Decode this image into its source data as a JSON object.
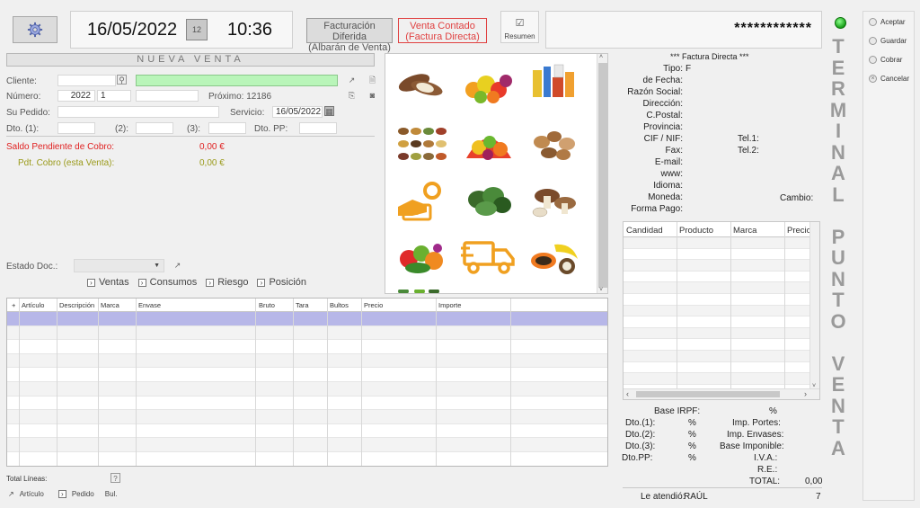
{
  "header": {
    "date": "16/05/2022",
    "time": "10:36",
    "cal_day": "12",
    "mode_deferred_line1": "Facturación Diferida",
    "mode_deferred_line2": "(Albarán de Venta)",
    "mode_cash_line1": "Venta Contado",
    "mode_cash_line2": "(Factura Directa)",
    "summary_label": "Resumen",
    "user_masked": "************"
  },
  "terminal_letters": [
    "T",
    "E",
    "R",
    "M",
    "I",
    "N",
    "A",
    "L",
    "",
    "P",
    "U",
    "N",
    "T",
    "O",
    "",
    "V",
    "E",
    "N",
    "T",
    "A"
  ],
  "side_actions": [
    "Aceptar",
    "Guardar",
    "Cobrar",
    "Cancelar"
  ],
  "form": {
    "title": "NUEVA VENTA",
    "cliente_label": "Cliente:",
    "numero_label": "Número:",
    "numero_year": "2022",
    "numero_value": "1",
    "proximo_label": "Próximo:",
    "proximo_value": "12186",
    "su_pedido_label": "Su Pedido:",
    "servicio_label": "Servicio:",
    "servicio_value": "16/05/2022",
    "dto1_label": "Dto. (1):",
    "dto2_label": "(2):",
    "dto3_label": "(3):",
    "dtopp_label": "Dto. PP:",
    "saldo_label": "Saldo Pendiente de Cobro:",
    "saldo_value": "0,00  €",
    "pdt_label": "Pdt. Cobro (esta Venta):",
    "pdt_value": "0,00  €",
    "estado_label": "Estado Doc.:",
    "links": [
      "Ventas",
      "Consumos",
      "Riesgo",
      "Posición"
    ]
  },
  "grid": {
    "columns": [
      "+",
      "Artículo",
      "Descripción",
      "Marca",
      "Envase",
      "Bruto",
      "Tara",
      "Bultos",
      "Precio",
      "Importe"
    ]
  },
  "footer": {
    "total_lineas_label": "Total Líneas:",
    "total_lineas_icon": "?",
    "articulo": "Artículo",
    "pedido": "Pedido",
    "bul": "Bul."
  },
  "invoice": {
    "heading": "*** Factura Directa ***",
    "tipo_label": "Tipo:",
    "tipo_value": "F",
    "fields": [
      "de Fecha:",
      "Razón Social:",
      "Dirección:",
      "C.Postal:",
      "Provincia:",
      "CIF / NIF:",
      "Fax:",
      "E-mail:",
      "www:",
      "Idioma:",
      "Moneda:",
      "Forma Pago:"
    ],
    "tel1_label": "Tel.1:",
    "tel2_label": "Tel.2:",
    "cambio_label": "Cambio:"
  },
  "product_table": {
    "columns": [
      "Candidad",
      "Producto",
      "Marca",
      "Precio"
    ]
  },
  "totals": {
    "base_irpf": "Base IRPF:",
    "pct": "%",
    "dto1": "Dto.(1):",
    "dto2": "Dto.(2):",
    "dto3": "Dto.(3):",
    "dtopp": "Dto.PP:",
    "imp_portes": "Imp. Portes:",
    "imp_envases": "Imp. Envases:",
    "base_imponible": "Base Imponible:",
    "iva": "I.V.A.:",
    "re": "R.E.:",
    "total_label": "TOTAL:",
    "total_value": "0,00",
    "atendio_label": "Le atendió:",
    "atendio_value": "RAÚL",
    "atendio_id": "7"
  }
}
